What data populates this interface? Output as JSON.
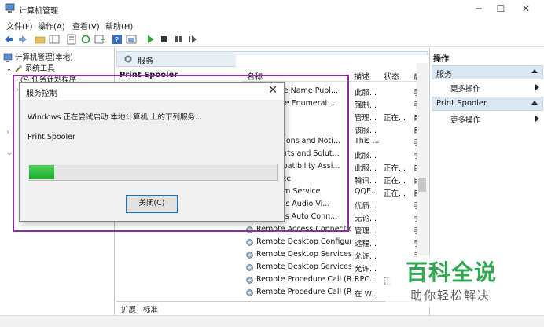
{
  "window": {
    "title": "计算机管理",
    "minimize": "─",
    "maximize": "☐",
    "close": "✕"
  },
  "menu": [
    "文件(F)",
    "操作(A)",
    "查看(V)",
    "帮助(H)"
  ],
  "tree": {
    "root": "计算机管理(本地)",
    "system_tools": "系统工具",
    "task_scheduler": "任务计划程序"
  },
  "center": {
    "header": "服务",
    "selected_service": "Print Spooler",
    "columns": {
      "name": "名称",
      "description": "描述",
      "status": "状态",
      "startup": "启"
    },
    "rows": [
      {
        "name": "...achine Name Publ...",
        "desc": "此服...",
        "status": "",
        "startup": "手"
      },
      {
        "name": "...Device Enumerat...",
        "desc": "强制...",
        "status": "",
        "startup": "手"
      },
      {
        "name": "",
        "desc": "管理...",
        "status": "正在...",
        "startup": "自"
      },
      {
        "name": "...ooler",
        "desc": "该服...",
        "status": "",
        "startup": "自"
      },
      {
        "name": "...xtensions and Noti...",
        "desc": "This ...",
        "status": "",
        "startup": "手"
      },
      {
        "name": "... Reports and Solut...",
        "desc": "此服...",
        "status": "",
        "startup": "手"
      },
      {
        "name": "... Compatibility Assi...",
        "desc": "此服...",
        "status": "正在...",
        "startup": "自"
      },
      {
        "name": "...Service",
        "desc": "腾讯...",
        "status": "正在...",
        "startup": "自"
      },
      {
        "name": "...latform Service",
        "desc": "QQE...",
        "status": "正在...",
        "startup": "自"
      },
      {
        "name": "...indows Audio Vi...",
        "desc": "优质...",
        "status": "",
        "startup": "手"
      },
      {
        "name": "...Access Auto Conn...",
        "desc": "无论...",
        "status": "",
        "startup": "手"
      },
      {
        "name": "Remote Access Connectio...",
        "desc": "管理...",
        "status": "",
        "startup": "手"
      },
      {
        "name": "Remote Desktop Configur...",
        "desc": "远程...",
        "status": "",
        "startup": "手"
      },
      {
        "name": "Remote Desktop Services",
        "desc": "允许...",
        "status": "",
        "startup": "手"
      },
      {
        "name": "Remote Desktop Services ...",
        "desc": "允许...",
        "status": "",
        "startup": "手"
      },
      {
        "name": "Remote Procedure Call (R...",
        "desc": "RPC...",
        "status": "正",
        "startup": ""
      },
      {
        "name": "Remote Procedure Call (R...",
        "desc": "在 W...",
        "status": "",
        "startup": ""
      }
    ],
    "tabs": [
      "扩展",
      "标准"
    ]
  },
  "actions": {
    "header": "操作",
    "section1": "服务",
    "more1": "更多操作",
    "section2": "Print Spooler",
    "more2": "更多操作"
  },
  "dialog": {
    "title": "服务控制",
    "message": "Windows 正在尝试启动 本地计算机 上的下列服务...",
    "service": "Print Spooler",
    "progress": 0.1,
    "close_button": "关闭(C)"
  },
  "watermark": {
    "title": "百科全说",
    "subtitle": "助你轻松解决"
  }
}
